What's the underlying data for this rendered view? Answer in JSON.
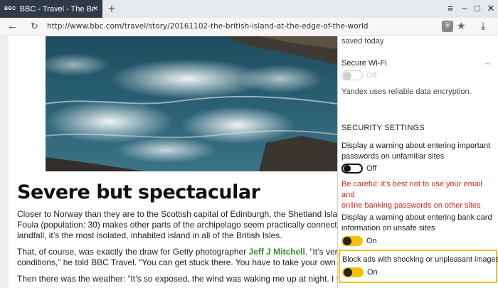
{
  "tab": {
    "site_badge": "BBC",
    "title": "BBC - Travel - The British"
  },
  "address": {
    "url": "http://www.bbc.com/travel/story/20161102-the-british-island-at-the-edge-of-the-world"
  },
  "article": {
    "headline": "Severe but spectacular",
    "paragraphs": [
      {
        "lines": [
          "Closer to Norway than they are to the Scottish capital of Edinburgh, the Shetland Islands are",
          "Foula (population: 30) makes other parts of the archipelago seem practically connected. Lo",
          "landfall, it’s the most isolated, inhabited island in all of the British Isles."
        ]
      },
      {
        "line1_before": "That, of course, was exactly the draw for Getty photographer ",
        "link": "Jeff J Mitchell",
        "line1_after": ". “It’s very diff",
        "line2": "conditions,” he told BBC Travel. “You can get stuck there. You have to take your own food"
      },
      {
        "lines": [
          "Then there was the weather: “It’s so exposed, the wind was waking me up at night. I felt it"
        ]
      }
    ]
  },
  "panel": {
    "saved_today": "saved today",
    "secure_wifi": {
      "label": "Secure Wi-Fi",
      "state": "Off",
      "note": "Yandex uses reliable data encryption."
    },
    "security_heading": "SECURITY SETTINGS",
    "password_warning": {
      "line1": "Display a warning about entering important",
      "line2": "passwords on unfamiliar sites",
      "state": "Off",
      "caution_line1": "Be careful: it's best not to use your email and",
      "caution_line2": "online banking passwords on other sites"
    },
    "bank_warning": {
      "line1": "Display a warning about entering bank card",
      "line2": "information on unsafe sites",
      "state": "On"
    },
    "block_ads": {
      "label": "Block ads with shocking or unpleasant images",
      "state": "On"
    }
  },
  "colors": {
    "toggle_on": "#f2c200",
    "caution": "#d4291f",
    "link": "#3a8f2b",
    "tab_bg": "#2f3b47"
  }
}
